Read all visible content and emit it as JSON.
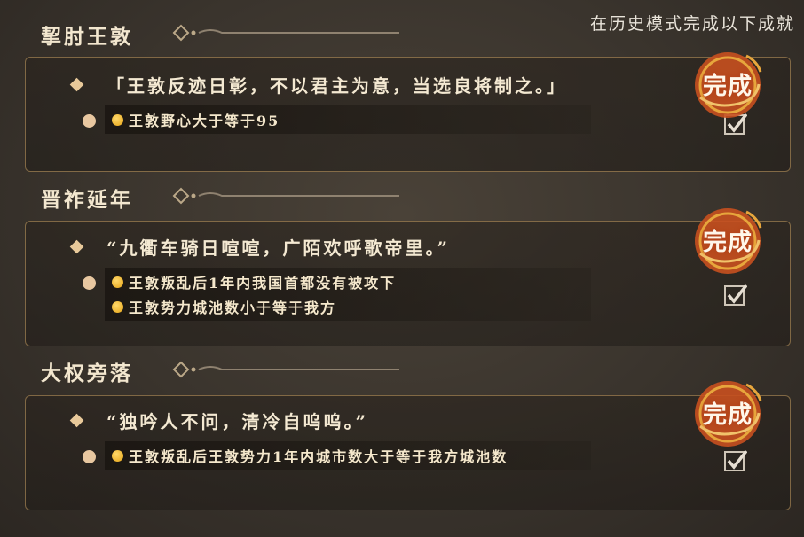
{
  "header_hint": "在历史模式完成以下成就",
  "achievements": [
    {
      "title": "挈肘王敦",
      "quote": "「王敦反迹日彰，不以君主为意，当选良将制之。」",
      "conditions": [
        "王敦野心大于等于95"
      ],
      "seal_label": "完成",
      "checked": true
    },
    {
      "title": "晋祚延年",
      "quote": "“九衢车骑日喧喧，广陌欢呼歌帝里。”",
      "conditions": [
        "王敦叛乱后1年内我国首都没有被攻下",
        "王敦势力城池数小于等于我方"
      ],
      "seal_label": "完成",
      "checked": true
    },
    {
      "title": "大权旁落",
      "quote": "“独吟人不问，清冷自呜呜。”",
      "conditions": [
        "王敦叛乱后王敦势力1年内城市数大于等于我方城池数"
      ],
      "seal_label": "完成",
      "checked": true
    }
  ],
  "colors": {
    "seal_red": "#c8501f",
    "seal_gold": "#e7a63c",
    "check_color": "#cfc6b8"
  }
}
